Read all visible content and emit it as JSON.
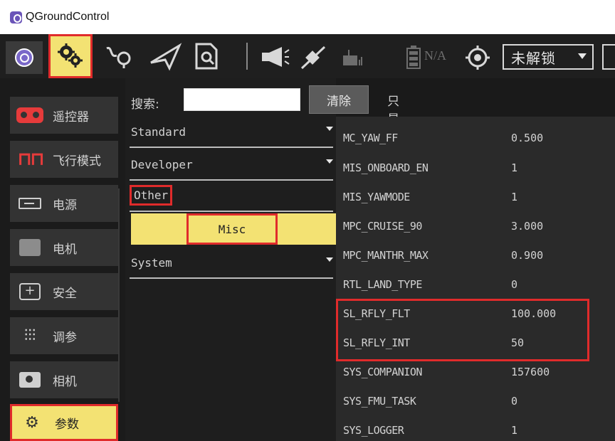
{
  "window": {
    "title": "QGroundControl"
  },
  "toolbar": {
    "na_text": "N/A",
    "arm_state": "未解锁"
  },
  "nav": {
    "items": [
      {
        "label": "遥控器",
        "icon": "remote-control-icon"
      },
      {
        "label": "飞行模式",
        "icon": "flight-modes-icon"
      },
      {
        "label": "电源",
        "icon": "battery-icon"
      },
      {
        "label": "电机",
        "icon": "motor-icon"
      },
      {
        "label": "安全",
        "icon": "safety-icon"
      },
      {
        "label": "调参",
        "icon": "tuning-icon"
      },
      {
        "label": "相机",
        "icon": "camera-icon"
      },
      {
        "label": "参数",
        "icon": "parameters-icon",
        "active": true
      }
    ]
  },
  "search": {
    "label": "搜索:",
    "value": "",
    "clear_label": "清除",
    "only_modified_label": "只显示修改",
    "only_modified_checked": false
  },
  "groups": [
    {
      "label": "Standard",
      "expanded": false
    },
    {
      "label": "Developer",
      "expanded": false
    },
    {
      "label": "Other",
      "expanded": true,
      "children": [
        "Misc"
      ],
      "selected_child": "Misc"
    },
    {
      "label": "System",
      "expanded": false
    }
  ],
  "params": [
    {
      "name": "MC_YAW_FF",
      "value": "0.500"
    },
    {
      "name": "MIS_ONBOARD_EN",
      "value": "1"
    },
    {
      "name": "MIS_YAWMODE",
      "value": "1"
    },
    {
      "name": "MPC_CRUISE_90",
      "value": "3.000"
    },
    {
      "name": "MPC_MANTHR_MAX",
      "value": "0.900"
    },
    {
      "name": "RTL_LAND_TYPE",
      "value": "0"
    },
    {
      "name": "SL_RFLY_FLT",
      "value": "100.000",
      "highlighted": true
    },
    {
      "name": "SL_RFLY_INT",
      "value": "50",
      "highlighted": true
    },
    {
      "name": "SYS_COMPANION",
      "value": "157600"
    },
    {
      "name": "SYS_FMU_TASK",
      "value": "0"
    },
    {
      "name": "SYS_LOGGER",
      "value": "1"
    }
  ],
  "colors": {
    "accent_yellow": "#f3e273",
    "highlight_red": "#e02b2b",
    "toolbar_bg": "#1f1f1f",
    "panel_bg": "#2a2a2a"
  }
}
